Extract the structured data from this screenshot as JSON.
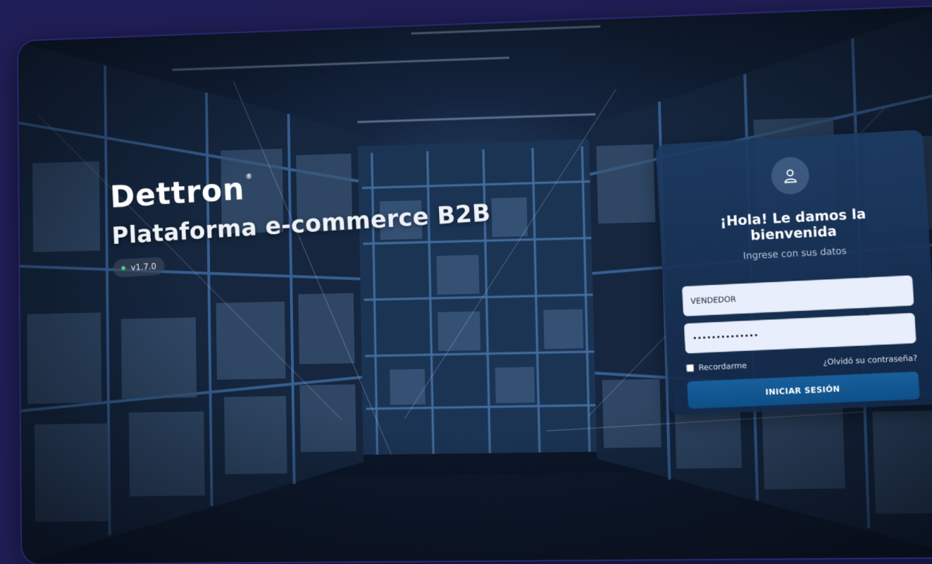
{
  "brand": {
    "logo": "Dettron",
    "registered": "®",
    "tagline": "Plataforma e-commerce B2B",
    "version": "v1.7.0",
    "status_color": "#3fd67a"
  },
  "login": {
    "avatar_icon": "user-icon",
    "greeting": "¡Hola! Le damos la bienvenida",
    "hint": "Ingrese con sus datos",
    "username_value": "VENDEDOR",
    "password_value": "••••••••••••••",
    "remember_label": "Recordarme",
    "forgot_label": "¿Olvidó su contraseña?",
    "submit_label": "INICIAR SESIÓN",
    "accent_color": "#0e4f88"
  }
}
